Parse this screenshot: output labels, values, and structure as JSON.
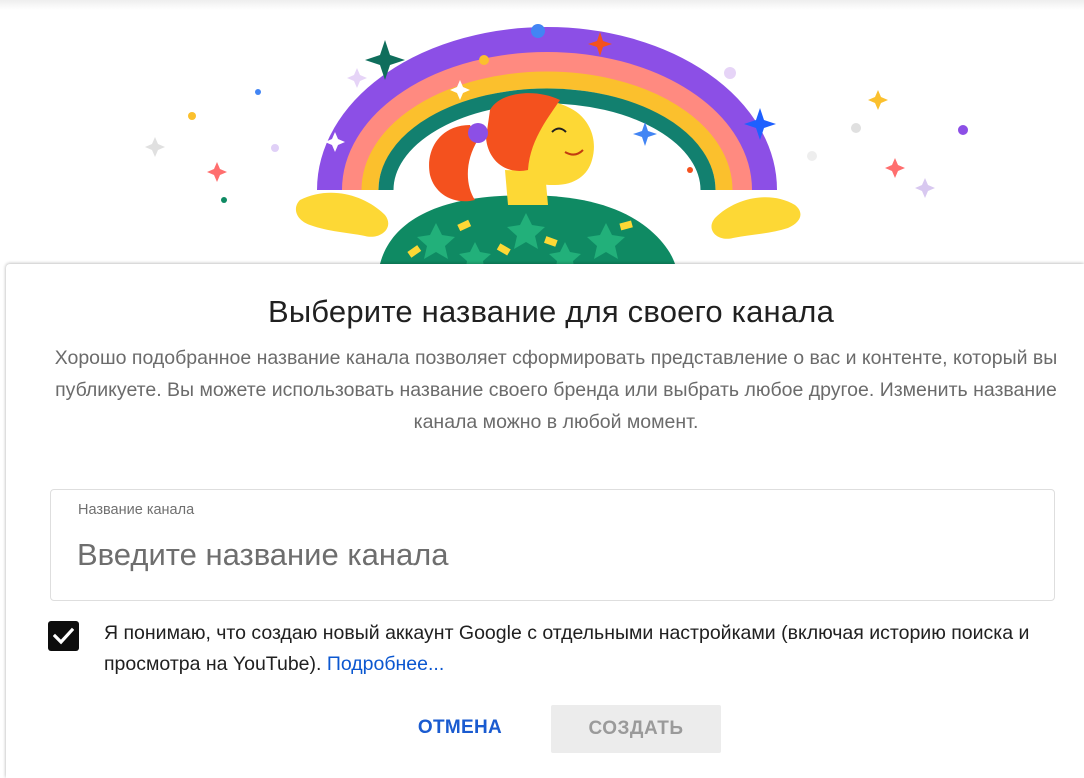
{
  "dialog": {
    "title": "Выберите название для своего канала",
    "description": "Хорошо подобранное название канала позволяет сформировать представление о вас и контенте, который вы публикуете. Вы можете использовать название своего бренда или выбрать любое другое. Изменить название канала можно в любой момент.",
    "field": {
      "label": "Название канала",
      "value": "",
      "placeholder": "Введите название канала"
    },
    "consent": {
      "checked": true,
      "text": "Я понимаю, что создаю новый аккаунт Google с отдельными настройками (включая историю поиска и просмотра на YouTube).",
      "link": "Подробнее..."
    },
    "actions": {
      "cancel_label": "ОТМЕНА",
      "create_label": "СОЗДАТЬ",
      "create_enabled": false
    }
  },
  "illustration": {
    "icon": "rainbow-person-illustration",
    "colors": {
      "rainbow_outer": "#8c4fe6",
      "rainbow_pink": "#ff8a80",
      "rainbow_yellow": "#fbc02d",
      "rainbow_inner": "#12806f",
      "hair": "#f4511e",
      "skin": "#fdd835",
      "shirt": "#0f8a63"
    }
  },
  "colors": {
    "accent": "#1a5bd0",
    "link": "#0b57d0",
    "checkbox": "#0d0d0d",
    "disabled_button_bg": "#ececec",
    "disabled_button_text": "#9a9a9a"
  }
}
